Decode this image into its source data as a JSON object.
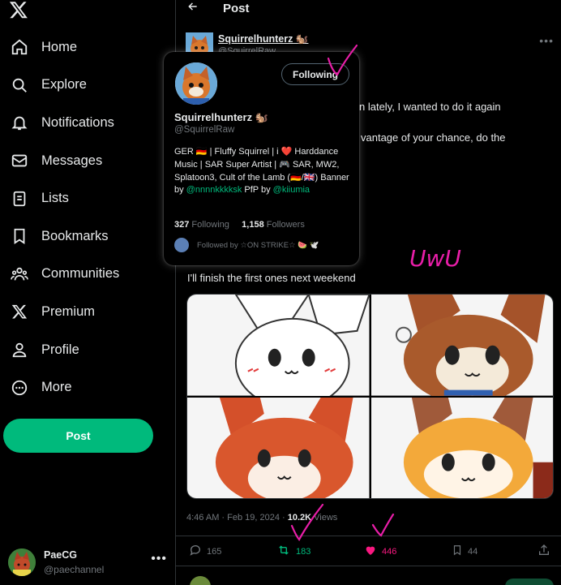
{
  "colors": {
    "accent": "#00ba7c",
    "like": "#f91880",
    "annotation": "#e81ea8"
  },
  "sidebar": {
    "items": [
      {
        "label": "Home",
        "icon": "home-icon"
      },
      {
        "label": "Explore",
        "icon": "search-icon"
      },
      {
        "label": "Notifications",
        "icon": "bell-icon"
      },
      {
        "label": "Messages",
        "icon": "envelope-icon"
      },
      {
        "label": "Lists",
        "icon": "list-icon"
      },
      {
        "label": "Bookmarks",
        "icon": "bookmark-icon"
      },
      {
        "label": "Communities",
        "icon": "people-icon"
      },
      {
        "label": "Premium",
        "icon": "x-logo-icon"
      },
      {
        "label": "Profile",
        "icon": "person-icon"
      },
      {
        "label": "More",
        "icon": "more-circle-icon"
      }
    ],
    "post_label": "Post",
    "account": {
      "display_name": "PaeCG",
      "handle": "@paechannel"
    }
  },
  "header": {
    "title": "Post"
  },
  "tweet": {
    "author_name": "Squirrelhunterz 🐿️",
    "author_handle": "@SquirrelRaw",
    "line1": "n lately, I wanted to do it again",
    "line2": "vantage of your chance, do the",
    "line3": "I'll finish the first ones next weekend",
    "time": "4:46 AM · Feb 19, 2024 · ",
    "views_count": "10.2K",
    "views_label": " Views",
    "replies": "165",
    "reposts": "183",
    "likes": "446",
    "bookmarks": "44"
  },
  "hover_card": {
    "button_label": "Following",
    "name": "Squirrelhunterz 🐿️",
    "handle": "@SquirrelRaw",
    "bio_1": "GER 🇩🇪 | Fluffy Squirrel | i ❤️ Harddance Music | SAR Super Artist | 🎮 SAR, MW2, Splatoon3, Cult of the Lamb (🇩🇪/🇬🇧) Banner by ",
    "bio_link1": "@nnnnkkkksk",
    "bio_2": " PfP by ",
    "bio_link2": "@kiiumia",
    "following_count": "327",
    "following_label": " Following",
    "followers_count": "1,158",
    "followers_label": " Followers",
    "followed_by": "Followed by ☆ON STRIKE☆ 🍉 🕊️"
  },
  "annotations": {
    "text": "UwU"
  }
}
